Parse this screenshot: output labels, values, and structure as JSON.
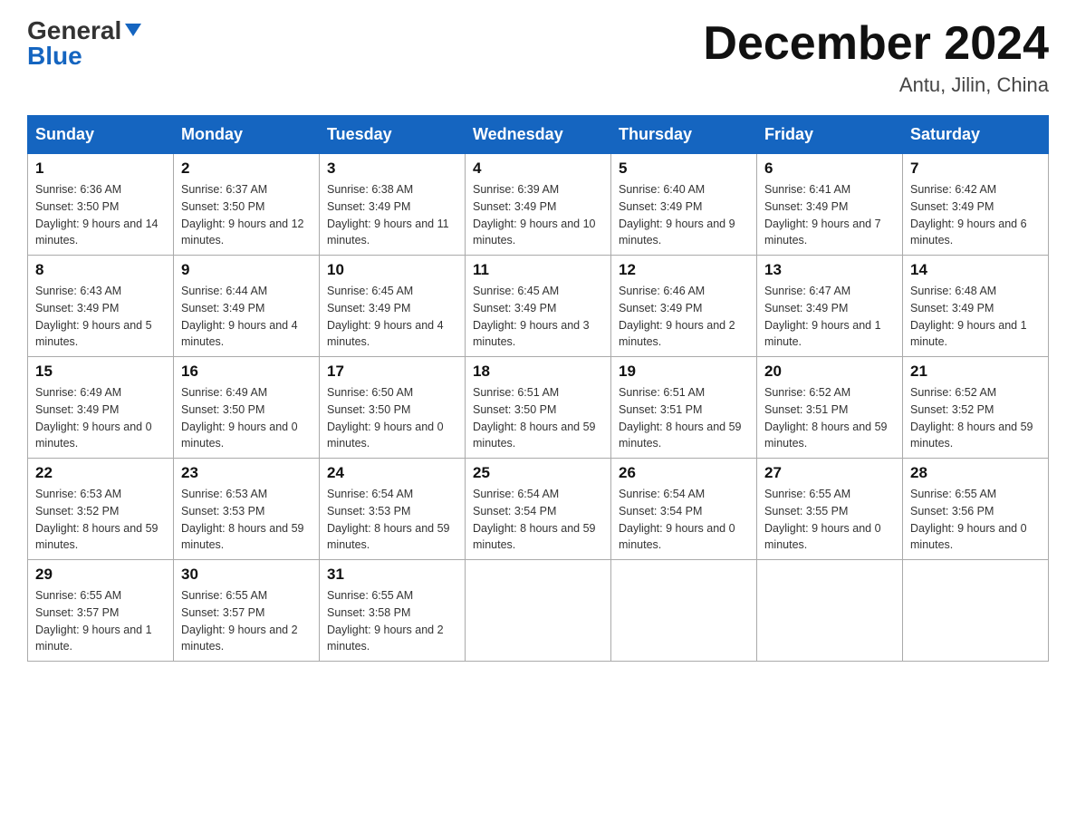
{
  "header": {
    "logo_general": "General",
    "logo_blue": "Blue",
    "title": "December 2024",
    "subtitle": "Antu, Jilin, China"
  },
  "days_of_week": [
    "Sunday",
    "Monday",
    "Tuesday",
    "Wednesday",
    "Thursday",
    "Friday",
    "Saturday"
  ],
  "weeks": [
    [
      {
        "day": "1",
        "sunrise": "6:36 AM",
        "sunset": "3:50 PM",
        "daylight": "9 hours and 14 minutes."
      },
      {
        "day": "2",
        "sunrise": "6:37 AM",
        "sunset": "3:50 PM",
        "daylight": "9 hours and 12 minutes."
      },
      {
        "day": "3",
        "sunrise": "6:38 AM",
        "sunset": "3:49 PM",
        "daylight": "9 hours and 11 minutes."
      },
      {
        "day": "4",
        "sunrise": "6:39 AM",
        "sunset": "3:49 PM",
        "daylight": "9 hours and 10 minutes."
      },
      {
        "day": "5",
        "sunrise": "6:40 AM",
        "sunset": "3:49 PM",
        "daylight": "9 hours and 9 minutes."
      },
      {
        "day": "6",
        "sunrise": "6:41 AM",
        "sunset": "3:49 PM",
        "daylight": "9 hours and 7 minutes."
      },
      {
        "day": "7",
        "sunrise": "6:42 AM",
        "sunset": "3:49 PM",
        "daylight": "9 hours and 6 minutes."
      }
    ],
    [
      {
        "day": "8",
        "sunrise": "6:43 AM",
        "sunset": "3:49 PM",
        "daylight": "9 hours and 5 minutes."
      },
      {
        "day": "9",
        "sunrise": "6:44 AM",
        "sunset": "3:49 PM",
        "daylight": "9 hours and 4 minutes."
      },
      {
        "day": "10",
        "sunrise": "6:45 AM",
        "sunset": "3:49 PM",
        "daylight": "9 hours and 4 minutes."
      },
      {
        "day": "11",
        "sunrise": "6:45 AM",
        "sunset": "3:49 PM",
        "daylight": "9 hours and 3 minutes."
      },
      {
        "day": "12",
        "sunrise": "6:46 AM",
        "sunset": "3:49 PM",
        "daylight": "9 hours and 2 minutes."
      },
      {
        "day": "13",
        "sunrise": "6:47 AM",
        "sunset": "3:49 PM",
        "daylight": "9 hours and 1 minute."
      },
      {
        "day": "14",
        "sunrise": "6:48 AM",
        "sunset": "3:49 PM",
        "daylight": "9 hours and 1 minute."
      }
    ],
    [
      {
        "day": "15",
        "sunrise": "6:49 AM",
        "sunset": "3:49 PM",
        "daylight": "9 hours and 0 minutes."
      },
      {
        "day": "16",
        "sunrise": "6:49 AM",
        "sunset": "3:50 PM",
        "daylight": "9 hours and 0 minutes."
      },
      {
        "day": "17",
        "sunrise": "6:50 AM",
        "sunset": "3:50 PM",
        "daylight": "9 hours and 0 minutes."
      },
      {
        "day": "18",
        "sunrise": "6:51 AM",
        "sunset": "3:50 PM",
        "daylight": "8 hours and 59 minutes."
      },
      {
        "day": "19",
        "sunrise": "6:51 AM",
        "sunset": "3:51 PM",
        "daylight": "8 hours and 59 minutes."
      },
      {
        "day": "20",
        "sunrise": "6:52 AM",
        "sunset": "3:51 PM",
        "daylight": "8 hours and 59 minutes."
      },
      {
        "day": "21",
        "sunrise": "6:52 AM",
        "sunset": "3:52 PM",
        "daylight": "8 hours and 59 minutes."
      }
    ],
    [
      {
        "day": "22",
        "sunrise": "6:53 AM",
        "sunset": "3:52 PM",
        "daylight": "8 hours and 59 minutes."
      },
      {
        "day": "23",
        "sunrise": "6:53 AM",
        "sunset": "3:53 PM",
        "daylight": "8 hours and 59 minutes."
      },
      {
        "day": "24",
        "sunrise": "6:54 AM",
        "sunset": "3:53 PM",
        "daylight": "8 hours and 59 minutes."
      },
      {
        "day": "25",
        "sunrise": "6:54 AM",
        "sunset": "3:54 PM",
        "daylight": "8 hours and 59 minutes."
      },
      {
        "day": "26",
        "sunrise": "6:54 AM",
        "sunset": "3:54 PM",
        "daylight": "9 hours and 0 minutes."
      },
      {
        "day": "27",
        "sunrise": "6:55 AM",
        "sunset": "3:55 PM",
        "daylight": "9 hours and 0 minutes."
      },
      {
        "day": "28",
        "sunrise": "6:55 AM",
        "sunset": "3:56 PM",
        "daylight": "9 hours and 0 minutes."
      }
    ],
    [
      {
        "day": "29",
        "sunrise": "6:55 AM",
        "sunset": "3:57 PM",
        "daylight": "9 hours and 1 minute."
      },
      {
        "day": "30",
        "sunrise": "6:55 AM",
        "sunset": "3:57 PM",
        "daylight": "9 hours and 2 minutes."
      },
      {
        "day": "31",
        "sunrise": "6:55 AM",
        "sunset": "3:58 PM",
        "daylight": "9 hours and 2 minutes."
      },
      null,
      null,
      null,
      null
    ]
  ],
  "labels": {
    "sunrise": "Sunrise:",
    "sunset": "Sunset:",
    "daylight": "Daylight:"
  }
}
